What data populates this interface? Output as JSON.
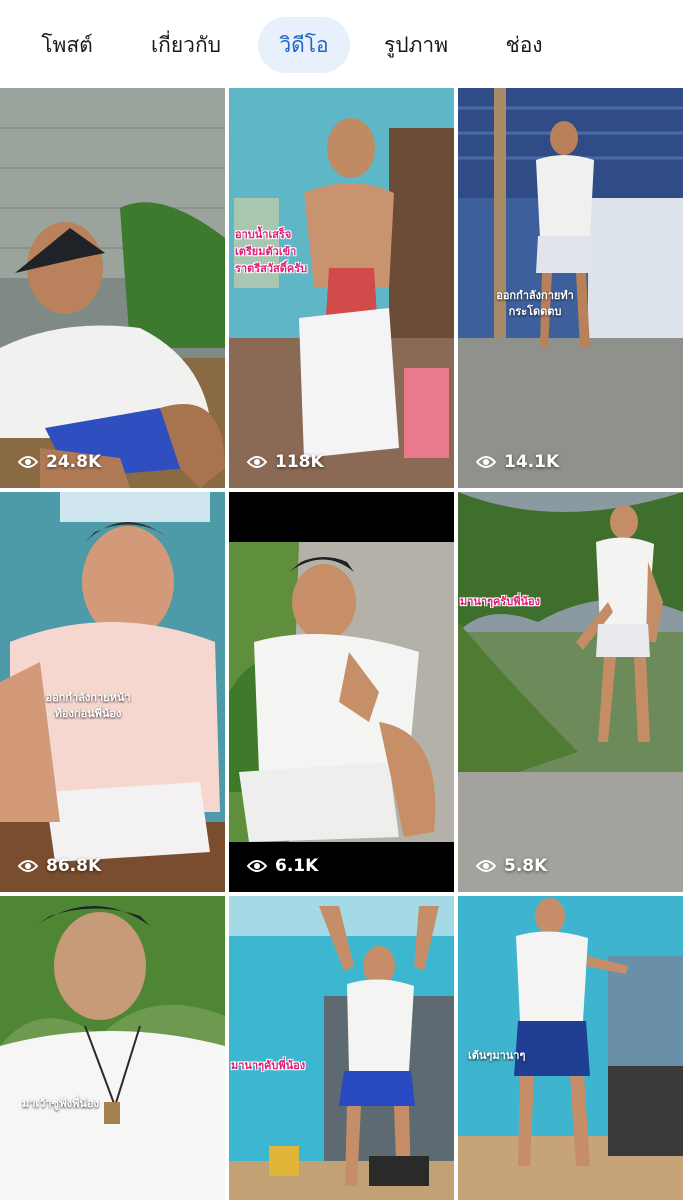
{
  "tabs": [
    {
      "label": "โพสต์",
      "active": false
    },
    {
      "label": "เกี่ยวกับ",
      "active": false
    },
    {
      "label": "วิดีโอ",
      "active": true
    },
    {
      "label": "รูปภาพ",
      "active": false
    },
    {
      "label": "ช่อง",
      "active": false
    }
  ],
  "videos": [
    {
      "views": "24.8K",
      "caption": ""
    },
    {
      "views": "118K",
      "caption": "อาบน้ำเสร็จ\nเตรียมตัวเข้า\nราตรีสวัสดิ์ครับ"
    },
    {
      "views": "14.1K",
      "caption": "ออกกำลังกายทำ\nกระโดดตบ"
    },
    {
      "views": "86.8K",
      "caption": "ออกกำลังกายหน้า\nท้องก่อนพี่น้อง"
    },
    {
      "views": "6.1K",
      "caption": ""
    },
    {
      "views": "5.8K",
      "caption": "มานาๆครับพี่น้อง"
    },
    {
      "views": "",
      "caption": "มาเว้าซูฟังพี่น้อง"
    },
    {
      "views": "",
      "caption": "มานาๆคับพี่น้อง"
    },
    {
      "views": "",
      "caption": "เต้นๆมานาๆ"
    }
  ],
  "icons": {
    "views": "eye-icon"
  },
  "colors": {
    "active_tab_bg": "#e7f0fb",
    "active_tab_text": "#1d66c8",
    "caption_pink": "#e0207a"
  }
}
